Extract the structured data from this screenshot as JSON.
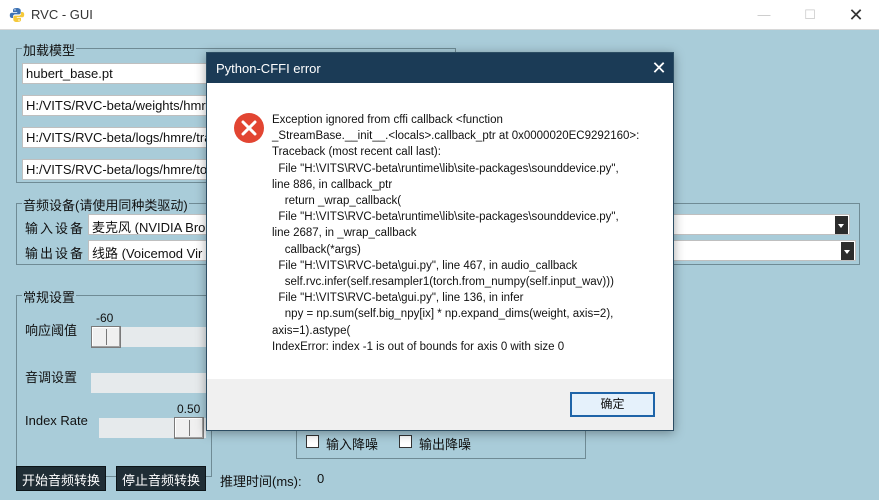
{
  "window": {
    "title": "RVC - GUI",
    "min_glyph": "—",
    "max_glyph": "☐",
    "close_glyph": "✕"
  },
  "model_group": {
    "legend": "加载模型",
    "hubert": "hubert_base.pt",
    "pth_path": "H:/VITS/RVC-beta/weights/hmre",
    "index_path": "H:/VITS/RVC-beta/logs/hmre/tra",
    "npy_path": "H:/VITS/RVC-beta/logs/hmre/to"
  },
  "audio_group": {
    "legend": "音频设备(请使用同种类驱动)",
    "input_label": "输入设备",
    "input_value": "麦克风 (NVIDIA Bro",
    "output_label": "输出设备",
    "output_value": "线路 (Voicemod Vir"
  },
  "general_group": {
    "legend": "常规设置",
    "threshold_label": "响应阈值",
    "threshold_value": "-60",
    "threshold_level": 0.0,
    "pitch_label": "音调设置",
    "index_label": "Index Rate",
    "index_value": "0.50",
    "index_level": 0.5
  },
  "noise": {
    "input_denoise": "输入降噪",
    "output_denoise": "输出降噪"
  },
  "bottom": {
    "start_button": "开始音频转换",
    "stop_button": "停止音频转换",
    "latency_label": "推理时间(ms):",
    "latency_value": "0"
  },
  "dialog": {
    "title": "Python-CFFI error",
    "message_lines": [
      "Exception ignored from cffi callback <function",
      "_StreamBase.__init__.<locals>.callback_ptr at 0x0000020EC9292160>:",
      "Traceback (most recent call last):",
      "  File \"H:\\VITS\\RVC-beta\\runtime\\lib\\site-packages\\sounddevice.py\",",
      "line 886, in callback_ptr",
      "    return _wrap_callback(",
      "  File \"H:\\VITS\\RVC-beta\\runtime\\lib\\site-packages\\sounddevice.py\",",
      "line 2687, in _wrap_callback",
      "    callback(*args)",
      "  File \"H:\\VITS\\RVC-beta\\gui.py\", line 467, in audio_callback",
      "    self.rvc.infer(self.resampler1(torch.from_numpy(self.input_wav)))",
      "  File \"H:\\VITS\\RVC-beta\\gui.py\", line 136, in infer",
      "    npy = np.sum(self.big_npy[ix] * np.expand_dims(weight, axis=2),",
      "axis=1).astype(",
      "IndexError: index -1 is out of bounds for axis 0 with size 0"
    ],
    "ok_label": "确定",
    "close_glyph": "✕"
  },
  "colors": {
    "background": "#a9ccd9",
    "dialog_title": "#1b3b56",
    "error_red": "#e24532",
    "dark_button": "#1f2d35"
  }
}
